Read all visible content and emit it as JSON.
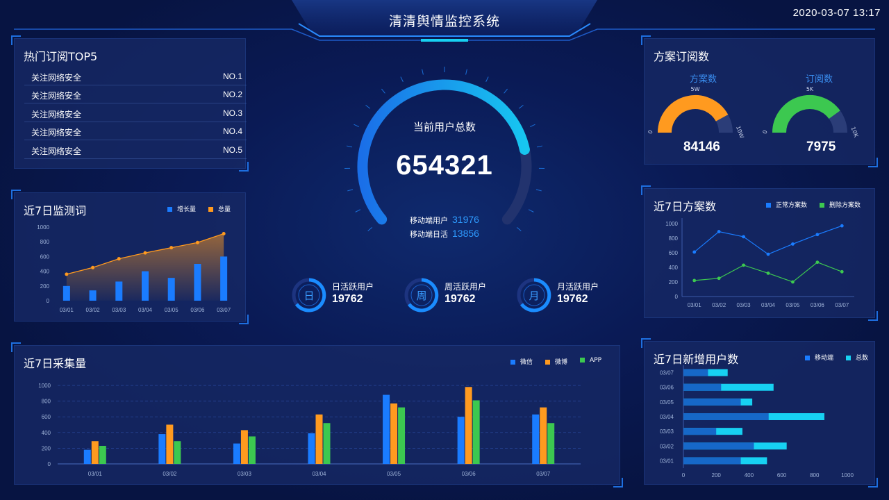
{
  "header": {
    "title": "清清舆情监控系统",
    "datetime": "2020-03-07  13:17"
  },
  "colors": {
    "blue": "#1a7cff",
    "orange": "#ff9a1f",
    "green": "#3cc850",
    "cyan": "#17d1f2",
    "accent": "#1e6fe0"
  },
  "top5": {
    "title": "热门订阅TOP5",
    "rows": [
      {
        "name": "关注网络安全",
        "rank": "NO.1"
      },
      {
        "name": "关注网络安全",
        "rank": "NO.2"
      },
      {
        "name": "关注网络安全",
        "rank": "NO.3"
      },
      {
        "name": "关注网络安全",
        "rank": "NO.4"
      },
      {
        "name": "关注网络安全",
        "rank": "NO.5"
      }
    ]
  },
  "center": {
    "label": "当前用户总数",
    "value": "654321",
    "progress": 0.8,
    "mobile_users_label": "移动端用户",
    "mobile_users_value": "31976",
    "mobile_daily_label": "移动端日活",
    "mobile_daily_value": "13856",
    "rings": [
      {
        "glyph": "日",
        "label": "日活跃用户",
        "value": "19762"
      },
      {
        "glyph": "周",
        "label": "周活跃用户",
        "value": "19762"
      },
      {
        "glyph": "月",
        "label": "月活跃用户",
        "value": "19762"
      }
    ]
  },
  "subscriptions": {
    "title": "方案订阅数",
    "gauges": [
      {
        "label": "方案数",
        "value": "84146",
        "min": "0",
        "mid": "5W",
        "max": "10W",
        "fraction": 0.84,
        "color": "#ff9a1f"
      },
      {
        "label": "订阅数",
        "value": "7975",
        "min": "0",
        "mid": "5K",
        "max": "10K",
        "fraction": 0.8,
        "color": "#3cc850"
      }
    ]
  },
  "chart_data": [
    {
      "id": "monitor",
      "type": "bar",
      "title": "近7日监测词",
      "categories": [
        "03/01",
        "03/02",
        "03/03",
        "03/04",
        "03/05",
        "03/06",
        "03/07"
      ],
      "series": [
        {
          "name": "增长量",
          "type": "bar",
          "values": [
            200,
            140,
            260,
            400,
            310,
            500,
            600
          ]
        },
        {
          "name": "总量",
          "type": "line-area",
          "values": [
            360,
            450,
            570,
            650,
            720,
            790,
            910
          ]
        }
      ],
      "ylim": [
        0,
        1000
      ],
      "yticks": [
        "0",
        "200",
        "400",
        "600",
        "800",
        "1000"
      ]
    },
    {
      "id": "collect",
      "type": "bar",
      "title": "近7日采集量",
      "categories": [
        "03/01",
        "03/02",
        "03/03",
        "03/04",
        "03/05",
        "03/06",
        "03/07"
      ],
      "series": [
        {
          "name": "微信",
          "values": [
            180,
            380,
            260,
            390,
            880,
            600,
            630
          ]
        },
        {
          "name": "微博",
          "values": [
            290,
            500,
            430,
            630,
            770,
            980,
            720
          ]
        },
        {
          "name": "APP",
          "values": [
            230,
            290,
            350,
            520,
            720,
            810,
            520
          ]
        }
      ],
      "ylim": [
        0,
        1000
      ],
      "yticks": [
        "0",
        "200",
        "400",
        "600",
        "800",
        "1000"
      ],
      "grid": true
    },
    {
      "id": "plans",
      "type": "line",
      "title": "近7日方案数",
      "categories": [
        "03/01",
        "03/02",
        "03/03",
        "03/04",
        "03/05",
        "03/06",
        "03/07"
      ],
      "series": [
        {
          "name": "正常方案数",
          "values": [
            610,
            890,
            820,
            580,
            720,
            850,
            970
          ]
        },
        {
          "name": "删除方案数",
          "values": [
            220,
            250,
            430,
            320,
            200,
            470,
            340
          ]
        }
      ],
      "ylim": [
        0,
        1000
      ],
      "yticks": [
        "0",
        "200",
        "400",
        "600",
        "800",
        "1000"
      ]
    },
    {
      "id": "newusers",
      "type": "bar",
      "orientation": "horizontal",
      "title": "近7日新增用户数",
      "categories": [
        "03/07",
        "03/06",
        "03/05",
        "03/04",
        "03/03",
        "03/02",
        "03/01"
      ],
      "series": [
        {
          "name": "移动端",
          "values": [
            150,
            230,
            350,
            520,
            200,
            430,
            350
          ]
        },
        {
          "name": "总数",
          "values": [
            270,
            550,
            420,
            860,
            360,
            630,
            510
          ]
        }
      ],
      "xlim": [
        0,
        1000
      ],
      "xticks": [
        "0",
        "200",
        "400",
        "600",
        "800",
        "1000"
      ]
    }
  ]
}
